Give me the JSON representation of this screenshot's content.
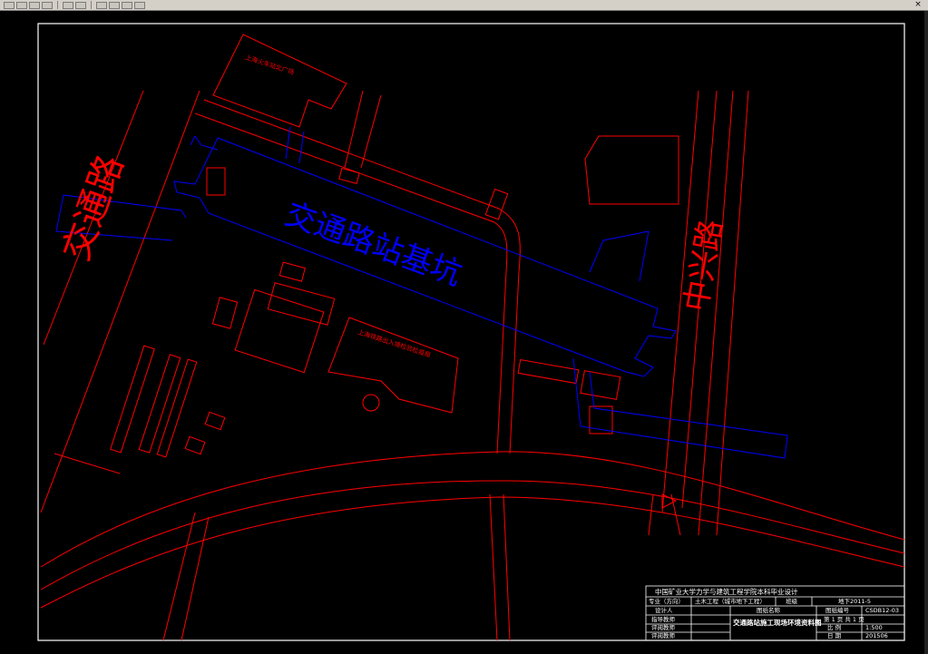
{
  "toolbar": {
    "close_glyph": "×",
    "icons": [
      "new-icon",
      "open-icon",
      "save-icon",
      "print-icon",
      "undo-icon",
      "redo-icon",
      "pan-icon",
      "zoom-icon",
      "properties-icon",
      "layer-icon"
    ]
  },
  "colors": {
    "background": "#000000",
    "border": "#ffffff",
    "roads": "#ff0000",
    "pit": "#0000ff",
    "title_block": "#ffffff"
  },
  "drawing": {
    "pit_label": "交通路站基坑",
    "road_label_left": "交通路",
    "road_label_right": "中兴路",
    "building_label_1": "上海火车站北广场",
    "building_label_2": "上海铁路出入境检验检疫局"
  },
  "title_block": {
    "header": "中国矿业大学力学与建筑工程学院本科毕业设计",
    "major_label": "专业（方向）",
    "major_value": "土木工程（城市地下工程）",
    "class_label": "班级",
    "class_value": "地下2011-5",
    "designer_label": "设计人",
    "drawing_name_label": "图纸名称",
    "drawing_no_label": "图纸编号",
    "drawing_no_value": "CSDB12-03",
    "advisor_label": "指导教师",
    "reviewer_label": "评阅教师",
    "defense_label": "评阅教师",
    "drawing_name_value": "交通路站施工现场环境资料图",
    "sheet_label": "第 1 页 共 1 页",
    "scale_label": "比 例",
    "scale_value": "1:500",
    "date_label": "日 期",
    "date_value": "201506"
  }
}
